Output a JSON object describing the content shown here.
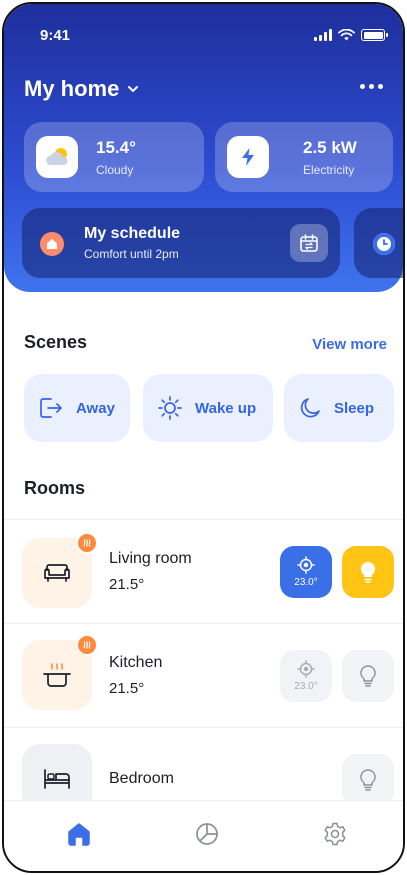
{
  "status_bar": {
    "time": "9:41"
  },
  "header": {
    "home_name": "My home"
  },
  "stats": [
    {
      "value": "15.4°",
      "label": "Cloudy",
      "icon": "weather-cloud-sun-icon"
    },
    {
      "value": "2.5 kW",
      "label": "Electricity",
      "icon": "lightning-icon"
    }
  ],
  "schedule": {
    "title": "My schedule",
    "subtitle": "Comfort until 2pm"
  },
  "scenes": {
    "title": "Scenes",
    "view_more": "View more",
    "items": [
      {
        "label": "Away",
        "icon": "exit-icon"
      },
      {
        "label": "Wake up",
        "icon": "sun-icon"
      },
      {
        "label": "Sleep",
        "icon": "moon-icon"
      }
    ]
  },
  "rooms": {
    "title": "Rooms",
    "items": [
      {
        "name": "Living room",
        "temp": "21.5°",
        "thermostat": "23.0°",
        "thermostat_on": true,
        "light_on": true,
        "heating": true,
        "icon": "sofa-icon"
      },
      {
        "name": "Kitchen",
        "temp": "21.5°",
        "thermostat": "23.0°",
        "thermostat_on": false,
        "light_on": false,
        "heating": true,
        "icon": "pot-icon"
      },
      {
        "name": "Bedroom",
        "temp": "",
        "light_on": false,
        "heating": false,
        "icon": "bed-icon"
      }
    ]
  },
  "nav": {
    "active": "home",
    "items": [
      "home-icon",
      "chart-pie-icon",
      "settings-gear-icon"
    ]
  },
  "colors": {
    "accent": "#3b6be8",
    "light_on": "#ffc414",
    "heat_badge": "#ff8a3d"
  }
}
